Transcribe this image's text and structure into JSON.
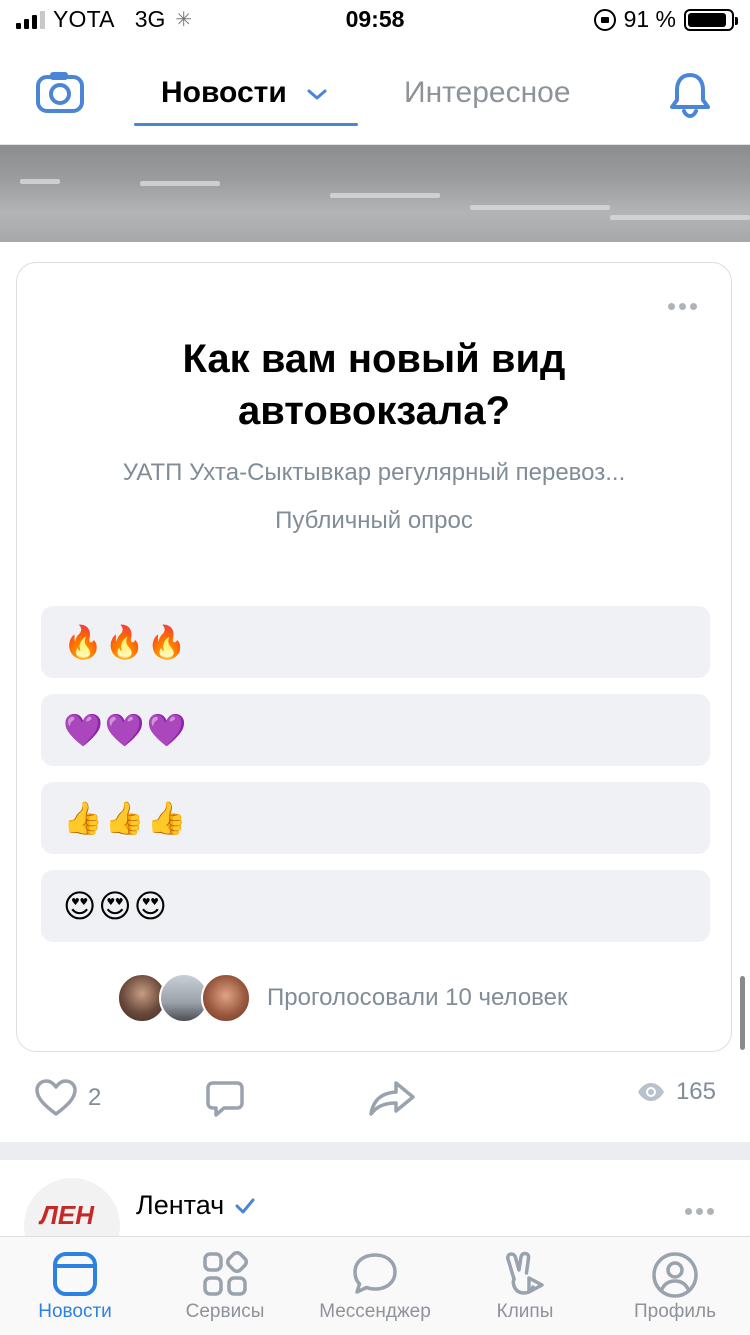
{
  "status_bar": {
    "carrier": "YOTA",
    "network": "3G",
    "time": "09:58",
    "battery_percent": "91 %",
    "battery_level": 0.91
  },
  "header": {
    "tabs": [
      {
        "label": "Новости",
        "active": true
      },
      {
        "label": "Интересное",
        "active": false
      }
    ],
    "icons": {
      "left": "camera-icon",
      "right": "bell-icon"
    }
  },
  "poll": {
    "title": "Как вам новый вид автовокзала?",
    "author": "УАТП Ухта-Сыктывкар регулярный перевоз...",
    "type": "Публичный опрос",
    "options": [
      {
        "label": "🔥🔥🔥"
      },
      {
        "label": "💜💜💜"
      },
      {
        "label": "👍👍👍"
      },
      {
        "label": "😍😍😍"
      }
    ],
    "voters_text": "Проголосовали 10 человек"
  },
  "actions": {
    "likes": "2",
    "views": "165"
  },
  "next_post": {
    "author": "Лентач",
    "verified": true,
    "avatar_text": "ЛЕН"
  },
  "tabbar": {
    "items": [
      {
        "label": "Новости",
        "icon": "news-icon",
        "active": true
      },
      {
        "label": "Сервисы",
        "icon": "services-icon",
        "active": false
      },
      {
        "label": "Мессенджер",
        "icon": "messenger-icon",
        "active": false
      },
      {
        "label": "Клипы",
        "icon": "clips-icon",
        "active": false
      },
      {
        "label": "Профиль",
        "icon": "profile-icon",
        "active": false
      }
    ]
  },
  "colors": {
    "accent": "#2d81e0",
    "tab_underline": "#4b86d6",
    "secondary_text": "#818c99",
    "option_bg": "#f0f1f4"
  }
}
